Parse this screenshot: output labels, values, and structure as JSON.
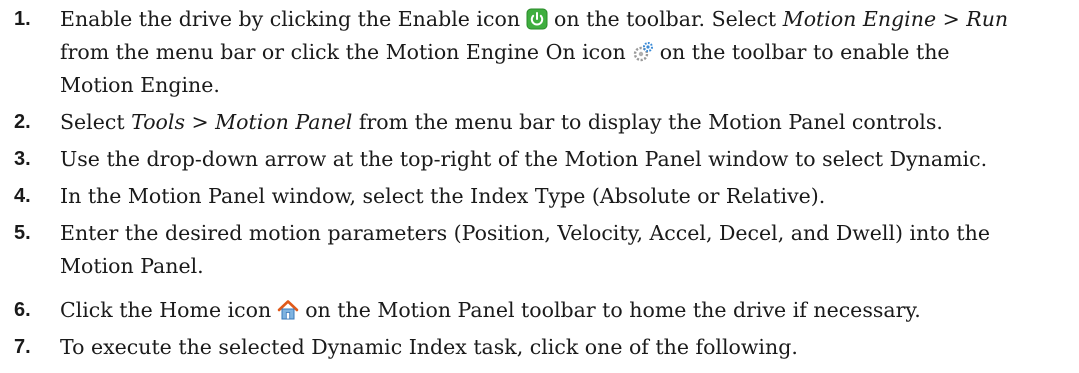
{
  "steps": [
    {
      "number": "1.",
      "a": "Enable the drive by clicking the Enable icon",
      "b": "on the toolbar. Select",
      "c": "Motion Engine > Run",
      "d": "from the menu bar or click the Motion Engine On icon",
      "e": "on the toolbar to enable the",
      "f": "Motion Engine."
    },
    {
      "number": "2.",
      "a": "Select",
      "b": "Tools > Motion Panel",
      "c": "from the menu bar to display the Motion Panel controls."
    },
    {
      "number": "3.",
      "text": "Use the drop-down arrow at the top-right of the Motion Panel window to select Dynamic."
    },
    {
      "number": "4.",
      "text": "In the Motion Panel window, select the Index Type (Absolute or Relative)."
    },
    {
      "number": "5.",
      "line1": "Enter the desired motion parameters (Position, Velocity, Accel, Decel, and Dwell) into the",
      "line2": "Motion Panel."
    },
    {
      "number": "6.",
      "a": "Click the Home icon",
      "b": "on the Motion Panel toolbar to home the drive if necessary."
    },
    {
      "number": "7.",
      "text": "To execute the selected Dynamic Index task, click one of the following."
    }
  ],
  "icons": {
    "enable": "power-icon",
    "motion_engine_on": "gears-icon",
    "home": "home-icon"
  }
}
